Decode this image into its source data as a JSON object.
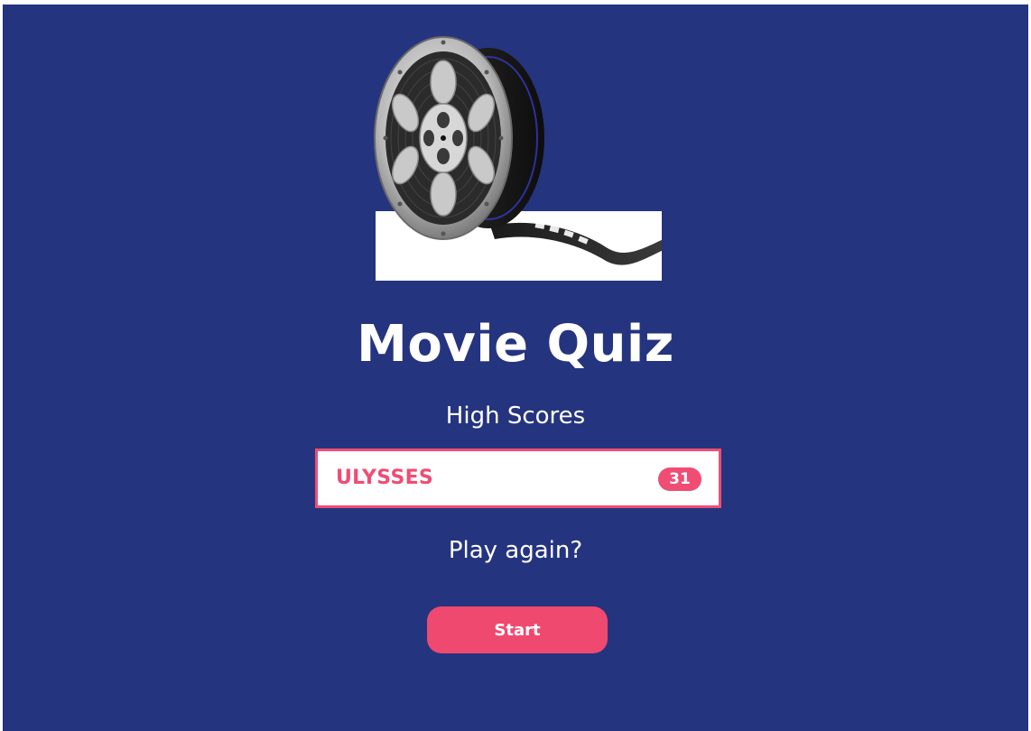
{
  "logo": {
    "icon": "film-reel-icon"
  },
  "title": "Movie Quiz",
  "high_scores": {
    "heading": "High Scores",
    "entries": [
      {
        "name": "ULYSSES",
        "score": "31"
      }
    ]
  },
  "play_again_label": "Play again?",
  "start_button_label": "Start",
  "colors": {
    "background": "#25347f",
    "accent": "#ef4d74",
    "text": "#ffffff"
  }
}
